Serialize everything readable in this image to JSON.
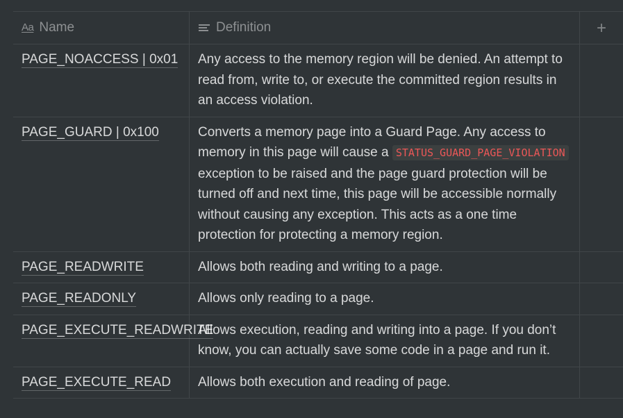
{
  "columns": {
    "name_icon": "Aa",
    "name_label": "Name",
    "definition_label": "Definition",
    "add_label": "+"
  },
  "rows": [
    {
      "name": "PAGE_NOACCESS | 0x01",
      "definition": "Any access to the memory region will be denied. An attempt to read from, write to, or execute the committed region results in an access violation."
    },
    {
      "name": "PAGE_GUARD | 0x100",
      "definition_before": "Converts a memory page into a Guard Page. Any access to memory in this page will cause a ",
      "definition_code": "STATUS_GUARD_PAGE_VIOLATION",
      "definition_after": " exception to be raised and the page guard protection will be turned off and next time, this page will be accessible normally without causing any exception. This acts as a one time protection for protecting a memory region."
    },
    {
      "name": "PAGE_READWRITE",
      "definition": "Allows both reading and writing to a page."
    },
    {
      "name": "PAGE_READONLY",
      "definition": "Allows only reading to a page."
    },
    {
      "name": "PAGE_EXECUTE_READWRITE",
      "definition": "Allows execution, reading and writing into a page.  If you don’t know, you can actually save some code in a page and run it."
    },
    {
      "name": "PAGE_EXECUTE_READ",
      "definition": "Allows both execution and reading of page."
    }
  ]
}
